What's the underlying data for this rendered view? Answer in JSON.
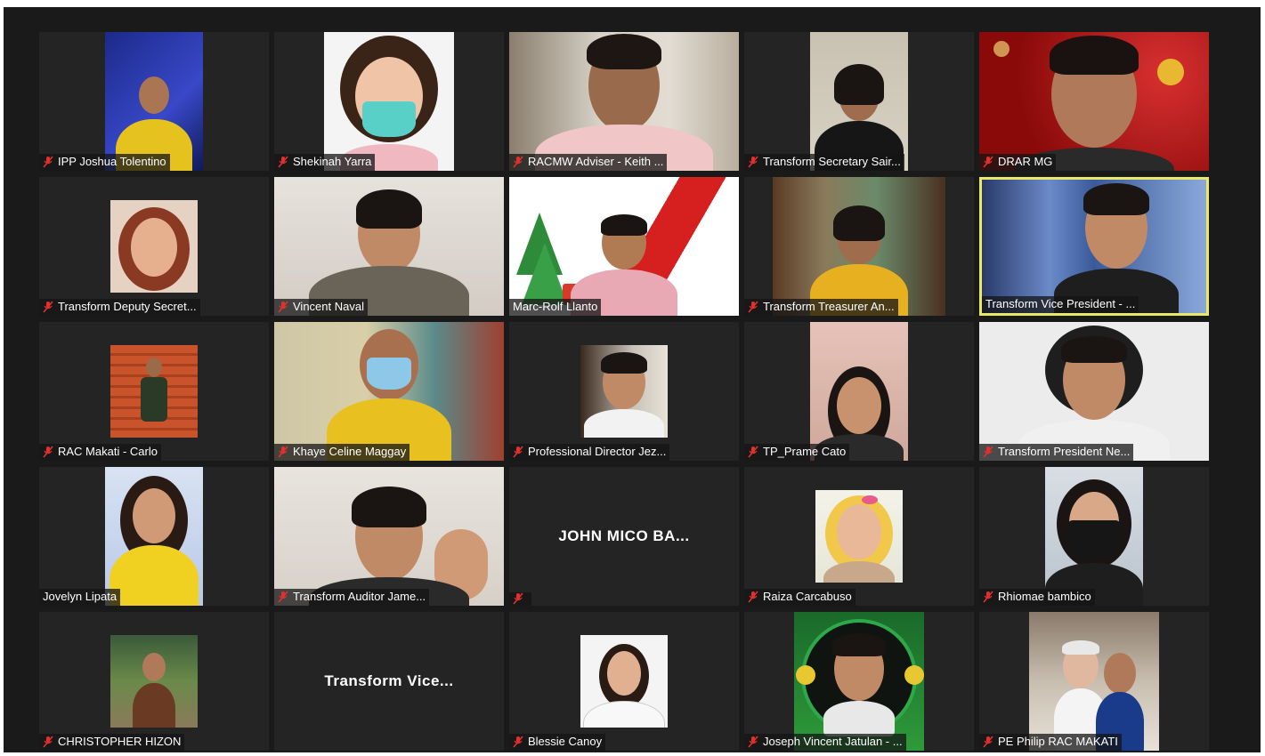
{
  "meeting": {
    "participants": [
      {
        "name": "IPP Joshua Tolentino",
        "muted": true,
        "video": true
      },
      {
        "name": "Shekinah Yarra",
        "muted": true,
        "video": true
      },
      {
        "name": "RACMW Adviser - Keith ...",
        "muted": true,
        "video": true
      },
      {
        "name": "Transform Secretary Sair...",
        "muted": true,
        "video": true
      },
      {
        "name": "DRAR MG",
        "muted": true,
        "video": true
      },
      {
        "name": "Transform Deputy Secret...",
        "muted": true,
        "video": true
      },
      {
        "name": "Vincent Naval",
        "muted": true,
        "video": true
      },
      {
        "name": "Marc-Rolf Llanto",
        "muted": false,
        "video": true
      },
      {
        "name": "Transform Treasurer An...",
        "muted": true,
        "video": true
      },
      {
        "name": "Transform Vice President - ...",
        "muted": false,
        "video": true,
        "active_speaker": true
      },
      {
        "name": "RAC Makati - Carlo",
        "muted": true,
        "video": true
      },
      {
        "name": "Khaye Celine Maggay",
        "muted": true,
        "video": true
      },
      {
        "name": "Professional Director Jez...",
        "muted": true,
        "video": true
      },
      {
        "name": "TP_Prame Cato",
        "muted": true,
        "video": true
      },
      {
        "name": "Transform President Ne...",
        "muted": true,
        "video": true
      },
      {
        "name": "Jovelyn Lipata",
        "muted": false,
        "video": true
      },
      {
        "name": "Transform Auditor Jame...",
        "muted": true,
        "video": true
      },
      {
        "name": "",
        "center_name": "JOHN MICO BA...",
        "muted": true,
        "video": false
      },
      {
        "name": "Raiza Carcabuso",
        "muted": true,
        "video": true
      },
      {
        "name": "Rhiomae bambico",
        "muted": true,
        "video": true
      },
      {
        "name": "CHRISTOPHER HIZON",
        "muted": true,
        "video": true
      },
      {
        "name": "",
        "center_name": "Transform Vice...",
        "muted": false,
        "video": false
      },
      {
        "name": "Blessie Canoy",
        "muted": true,
        "video": true
      },
      {
        "name": "Joseph Vincent Jatulan - ...",
        "muted": true,
        "video": true
      },
      {
        "name": "PE Philip RAC MAKATI",
        "muted": true,
        "video": true
      }
    ]
  },
  "colors": {
    "background": "#1a1a1a",
    "tile": "#242424",
    "active_speaker_border": "#e8e86a",
    "muted_icon": "#e0312f"
  },
  "icons": {
    "muted": "microphone-muted-icon"
  }
}
